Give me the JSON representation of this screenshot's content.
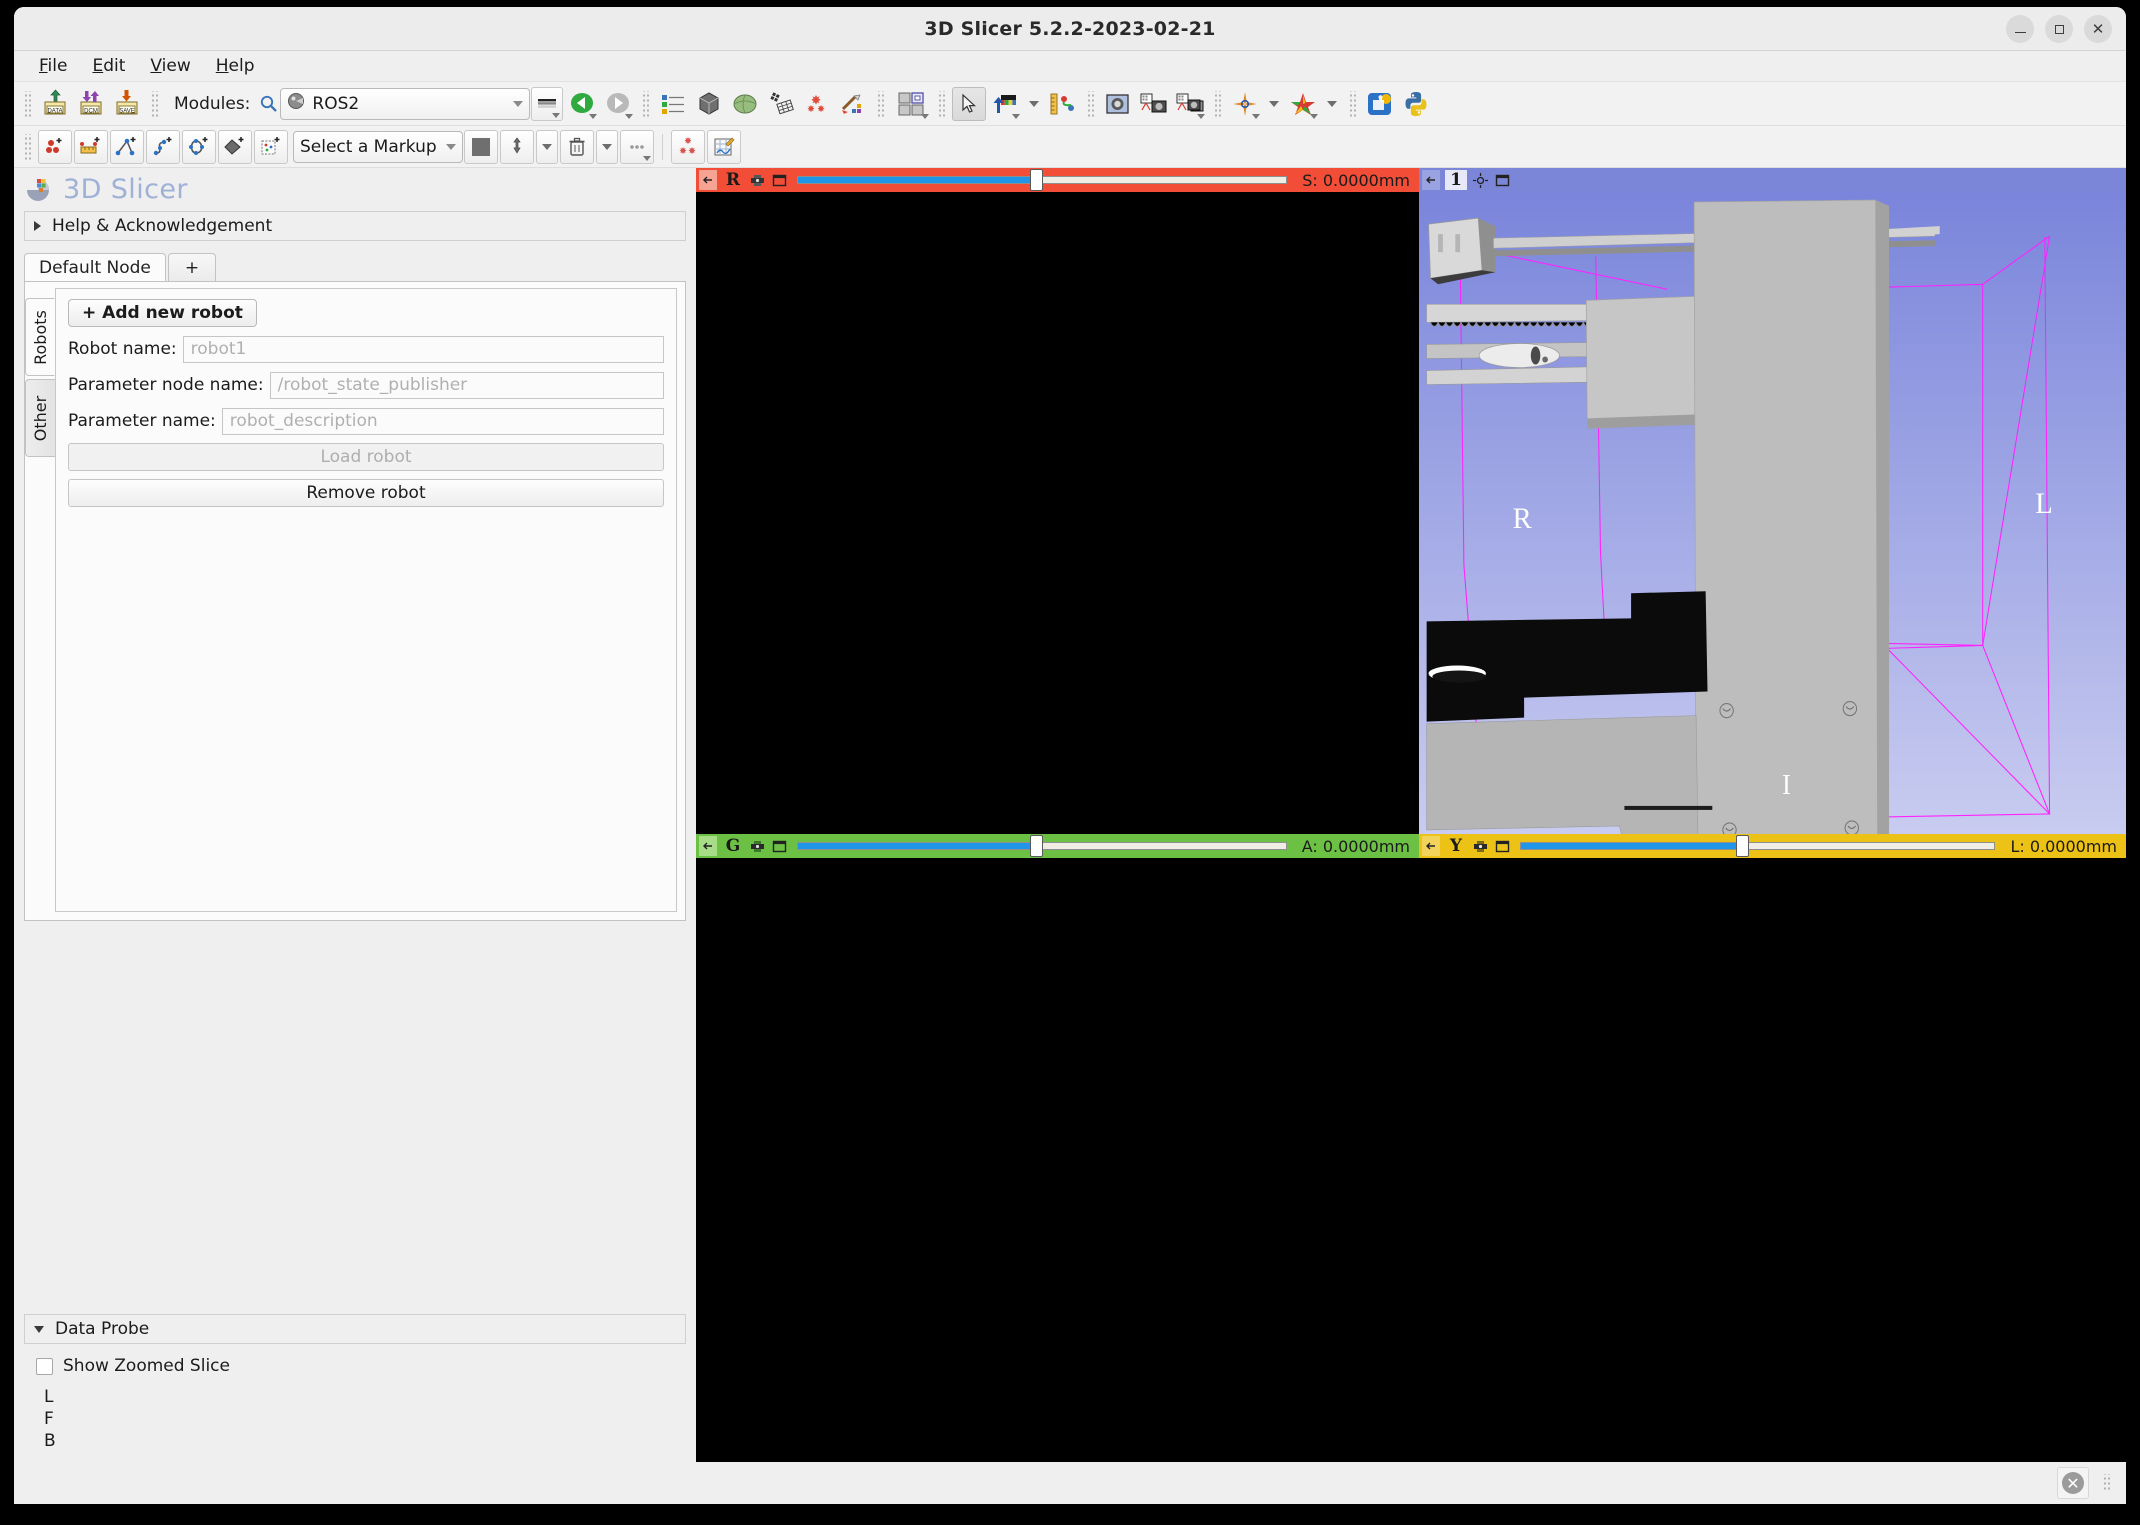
{
  "window": {
    "title": "3D Slicer 5.2.2-2023-02-21",
    "minimize_label": "–",
    "maximize_label": "□",
    "close_label": "✕"
  },
  "menubar": {
    "items": [
      {
        "label": "File",
        "mnemonic": "F"
      },
      {
        "label": "Edit",
        "mnemonic": "E"
      },
      {
        "label": "View",
        "mnemonic": "V"
      },
      {
        "label": "Help",
        "mnemonic": "H"
      }
    ]
  },
  "main_toolbar": {
    "load_data_icon": "load-data-icon",
    "load_data_label": "DATA",
    "dicom_icon": "dicom-icon",
    "dicom_label": "DCM",
    "save_icon": "save-data-icon",
    "save_label": "SAVE",
    "modules_label": "Modules:",
    "search_icon": "magnifier-icon",
    "module_selected": "ROS2",
    "module_icon": "ros2-module-icon",
    "favorites_icon": "favorite-modules-icon",
    "back_icon": "module-back-icon",
    "forward_icon": "module-forward-icon",
    "subject_hierarchy_icon": "subject-hierarchy-icon",
    "volume_rendering_icon": "volume-rendering-icon",
    "models_icon": "models-icon",
    "transforms_icon": "transforms-icon",
    "markups_icon": "markups-icon",
    "annotations_icon": "annotations-icon",
    "layout_icon": "layout-chooser-icon",
    "mouse_mode_icon": "mouse-pointer-icon",
    "place_module_icon": "capture-color-icon",
    "ruler_icon": "ruler-icon",
    "screenshot_icon": "screenshot-icon",
    "scene_views_icon": "scene-views-icon",
    "scene_views_capture_icon": "scene-views-capture-icon",
    "crosshair_icon": "crosshair-icon",
    "markups_star_icon": "markups-star-icon",
    "extensions_icon": "extensions-manager-icon",
    "python_icon": "python-console-icon"
  },
  "markups_toolbar": {
    "point_icon": "markup-point-add-icon",
    "line_icon": "markup-line-add-icon",
    "angle_icon": "markup-angle-add-icon",
    "curve_icon": "markup-open-curve-add-icon",
    "closed_curve_icon": "markup-closed-curve-add-icon",
    "plane_icon": "markup-plane-add-icon",
    "roi_icon": "markup-roi-add-icon",
    "markup_select_label": "Select a Markup",
    "color_swatch_icon": "color-swatch-icon",
    "place_persistent_icon": "place-persistent-icon",
    "delete_icon": "trash-icon",
    "more_icon": "more-options-icon",
    "jump_icon": "markups-visibility-icon",
    "edit_icon": "markups-edit-icon"
  },
  "left_panel": {
    "logo_icon": "slicer-logo-icon",
    "product_name": "3D Slicer",
    "help_section": "Help & Acknowledgement",
    "node_tabs": [
      {
        "label": "Default Node",
        "selected": true
      },
      {
        "label": "+",
        "selected": false
      }
    ],
    "vertical_tabs": [
      {
        "label": "Robots",
        "selected": true
      },
      {
        "label": "Other",
        "selected": false
      }
    ],
    "add_robot_button": "+ Add new robot",
    "fields": [
      {
        "label": "Robot name:",
        "placeholder": "robot1"
      },
      {
        "label": "Parameter node name:",
        "placeholder": "/robot_state_publisher"
      },
      {
        "label": "Parameter name:",
        "placeholder": "robot_description"
      }
    ],
    "load_robot_button": "Load robot",
    "remove_robot_button": "Remove robot"
  },
  "data_probe": {
    "section_title": "Data Probe",
    "show_zoomed_slice": "Show Zoomed Slice",
    "lines": [
      "L",
      "F",
      "B"
    ]
  },
  "views": {
    "red": {
      "pin_icon": "pin-icon",
      "letter": "R",
      "visibility_icon": "slice-visibility-icon",
      "maximize_icon": "view-maximize-icon",
      "coordinate": "S: 0.0000mm",
      "slider_percent": 50,
      "color": "#f14d37"
    },
    "green": {
      "pin_icon": "pin-icon",
      "letter": "G",
      "visibility_icon": "slice-visibility-icon",
      "maximize_icon": "view-maximize-icon",
      "coordinate": "A: 0.0000mm",
      "slider_percent": 50,
      "color": "#6cc044"
    },
    "yellow": {
      "pin_icon": "pin-icon",
      "letter": "Y",
      "visibility_icon": "slice-visibility-icon",
      "maximize_icon": "view-maximize-icon",
      "coordinate": "L: 0.0000mm",
      "slider_percent": 50,
      "color": "#edc217"
    },
    "threed": {
      "pin_icon": "pin-icon",
      "letter": "1",
      "center_icon": "center-view-icon",
      "maximize_icon": "view-maximize-icon",
      "color": "#7b86d8",
      "orientation_labels": [
        "R",
        "L",
        "I"
      ],
      "bounding_box_color": "#ff00ff",
      "model_color": "#b8b8b8"
    }
  },
  "statusbar": {
    "close_icon": "error-close-icon"
  }
}
